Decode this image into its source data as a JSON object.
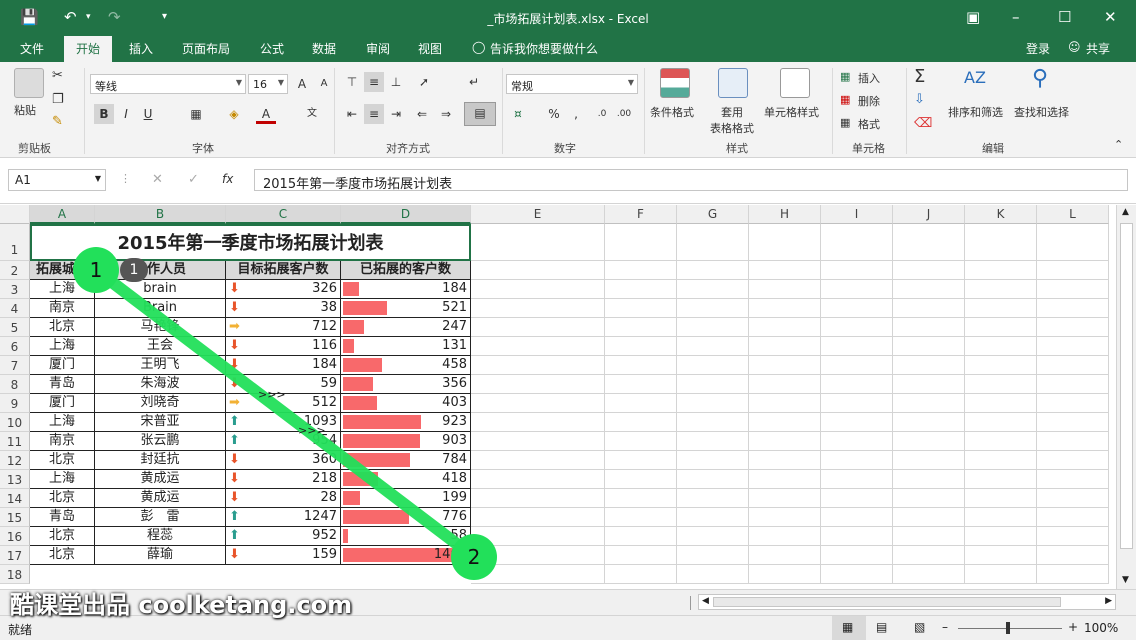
{
  "app": {
    "title": "_市场拓展计划表.xlsx - Excel"
  },
  "tabs": [
    "文件",
    "开始",
    "插入",
    "页面布局",
    "公式",
    "数据",
    "审阅",
    "视图"
  ],
  "tell_me": "告诉我你想要做什么",
  "account": {
    "login": "登录",
    "share": "共享"
  },
  "ribbon": {
    "paste": "粘贴",
    "font_name": "等线",
    "font_size": "16",
    "number_format": "常规",
    "bold": "B",
    "italic": "I",
    "underline": "U",
    "cond_format": "条件格式",
    "table_format": "套用\n表格格式",
    "cell_style": "单元格样式",
    "insert": "插入",
    "delete": "删除",
    "format": "格式",
    "sort_filter": "排序和筛选",
    "find_select": "查找和选择",
    "groups": {
      "clipboard": "剪贴板",
      "font": "字体",
      "alignment": "对齐方式",
      "number": "数字",
      "styles": "样式",
      "cells": "单元格",
      "editing": "编辑"
    }
  },
  "formula": {
    "namebox": "A1",
    "content": "2015年第一季度市场拓展计划表"
  },
  "columns": [
    "A",
    "B",
    "C",
    "D",
    "E",
    "F",
    "G",
    "H",
    "I",
    "J",
    "K",
    "L"
  ],
  "rows": [
    "1",
    "2",
    "3",
    "4",
    "5",
    "6",
    "7",
    "8",
    "9",
    "10",
    "11",
    "12",
    "13",
    "14",
    "15",
    "16",
    "17",
    "18"
  ],
  "sheet": {
    "title": "2015年第一季度市场拓展计划表",
    "headers": [
      "拓展城市",
      "工作人员",
      "目标拓展客户数",
      "已拓展的客户数"
    ],
    "data": [
      [
        "上海",
        "brain",
        "326",
        "184",
        "down"
      ],
      [
        "南京",
        "Brain",
        "38",
        "521",
        "down"
      ],
      [
        "北京",
        "马艳锋",
        "712",
        "247",
        "side"
      ],
      [
        "上海",
        "王会",
        "116",
        "131",
        "down"
      ],
      [
        "厦门",
        "王明飞",
        "184",
        "458",
        "down"
      ],
      [
        "青岛",
        "朱海波",
        "59",
        "356",
        "down"
      ],
      [
        "厦门",
        "刘晓奇",
        "512",
        "403",
        "side"
      ],
      [
        "上海",
        "宋普亚",
        "1093",
        "923",
        "up"
      ],
      [
        "南京",
        "张云鹏",
        "954",
        "903",
        "up"
      ],
      [
        "北京",
        "封廷抗",
        "360",
        "784",
        "down"
      ],
      [
        "上海",
        "黄成运",
        "218",
        "418",
        "down"
      ],
      [
        "北京",
        "黄成运",
        "28",
        "199",
        "down"
      ],
      [
        "青岛",
        "彭　雷",
        "1247",
        "776",
        "up"
      ],
      [
        "北京",
        "程蕊",
        "952",
        "58",
        "up"
      ],
      [
        "北京",
        "薛瑜",
        "159",
        "1461",
        "down"
      ]
    ]
  },
  "overlay": {
    "marker1": "1",
    "marker2": "2",
    "badge": "1"
  },
  "colors": {
    "accent": "#217346",
    "bar": "#f8696b",
    "up": "#2a9d8f",
    "down": "#e8542a",
    "side": "#f2b134"
  },
  "status": {
    "ready": "就绪",
    "zoom": "100%"
  },
  "watermark": "酷课堂出品 coolketang.com"
}
